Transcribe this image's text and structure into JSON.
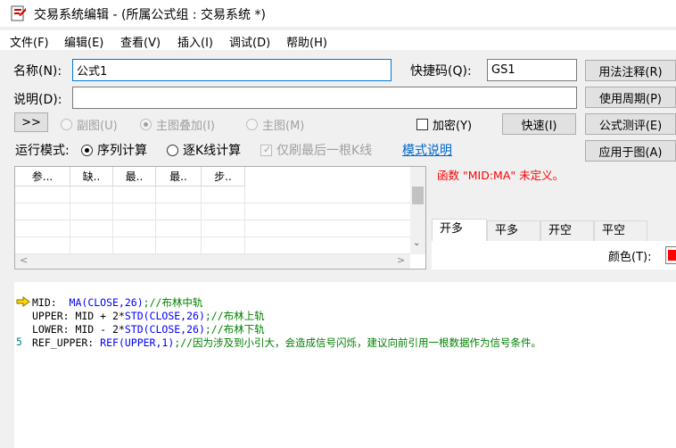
{
  "window": {
    "title": "交易系统编辑 - (所属公式组 : 交易系统 *)"
  },
  "menu": [
    "文件(F)",
    "编辑(E)",
    "查看(V)",
    "插入(I)",
    "调试(D)",
    "帮助(H)"
  ],
  "form": {
    "name_label": "名称(N):",
    "name_value": "公式1",
    "shortcut_label": "快捷码(Q):",
    "shortcut_value": "GS1",
    "desc_label": "说明(D):",
    "desc_value": ""
  },
  "right_buttons": [
    "用法注释(R)",
    "使用周期(P)",
    "公式测评(E)",
    "应用于图(A)"
  ],
  "options": {
    "expand_button": ">>",
    "sub_chart": "副图(U)",
    "main_overlay": "主图叠加(I)",
    "main_chart": "主图(M)",
    "encrypt": "加密(Y)",
    "quick_button": "快速(I)"
  },
  "run_mode": {
    "label": "运行模式:",
    "sequential": "序列计算",
    "per_bar": "逐K线计算",
    "refresh_last": "仅刷最后一根K线",
    "mode_help_link": "模式说明"
  },
  "param_table": {
    "headers": [
      "参...",
      "缺..",
      "最..",
      "最..",
      "步.."
    ],
    "rows": [
      [
        "",
        "",
        "",
        "",
        ""
      ],
      [
        "",
        "",
        "",
        "",
        ""
      ],
      [
        "",
        "",
        "",
        "",
        ""
      ],
      [
        "",
        "",
        "",
        "",
        ""
      ]
    ]
  },
  "error_message": "函数 \"MID:MA\" 未定义。",
  "signal_tabs": [
    "开多",
    "平多",
    "开空",
    "平空"
  ],
  "color_label": "颜色(T):",
  "colors": {
    "error": "#ff0000",
    "keyword": "#0000ff",
    "comment": "#008000",
    "swatch": "#ff0000",
    "link": "#0066cc"
  },
  "code": {
    "line1_a": "MID:  ",
    "line1_kw": "MA(CLOSE,26)",
    "line1_c": ";//布林中轨",
    "line2_a": "UPPER: MID + 2*",
    "line2_kw": "STD(CLOSE,26)",
    "line2_c": ";//布林上轨",
    "line3_a": "LOWER: MID - 2*",
    "line3_kw": "STD(CLOSE,26)",
    "line3_c": ";//布林下轨",
    "line4_a": "REF_UPPER: ",
    "line4_kw": "REF(UPPER,1)",
    "line4_c": ";//因为涉及到小引大，会造成信号闪烁，建议向前引用一根数据作为信号条件。",
    "line_number_5": "5"
  }
}
